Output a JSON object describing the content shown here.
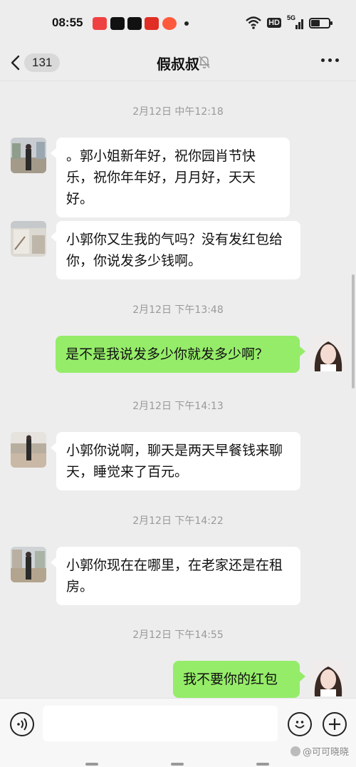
{
  "status_bar": {
    "time": "08:55",
    "app_icons": [
      {
        "name": "toutiao-app-icon",
        "color": "#f04142"
      },
      {
        "name": "douyin-app-icon",
        "color": "#111111"
      },
      {
        "name": "douyin-app-icon-2",
        "color": "#111111"
      },
      {
        "name": "pinduoduo-app-icon",
        "color": "#e02e24"
      },
      {
        "name": "kuaishou-app-icon",
        "color": "#ff5a3c"
      }
    ],
    "hd_label": "HD",
    "network": "5G"
  },
  "nav": {
    "unread_count": "131",
    "title": "假叔叔"
  },
  "messages": [
    {
      "type": "time",
      "text": "2月12日 中午12:18"
    },
    {
      "type": "in",
      "text": "。郭小姐新年好，祝你园肖节快乐，祝你年年好，月月好，天天好。"
    },
    {
      "type": "in",
      "text": "小郭你又生我的气吗？没有发红包给你，你说发多少钱啊。"
    },
    {
      "type": "time",
      "text": "2月12日 下午13:48"
    },
    {
      "type": "out",
      "text": "是不是我说发多少你就发多少啊？"
    },
    {
      "type": "time",
      "text": "2月12日 下午14:13"
    },
    {
      "type": "in",
      "text": "小郭你说啊，聊天是两天早餐钱来聊天，睡觉来了百元。"
    },
    {
      "type": "time",
      "text": "2月12日 下午14:22"
    },
    {
      "type": "in",
      "text": "小郭你现在在哪里，在老家还是在租房。"
    },
    {
      "type": "time",
      "text": "2月12日 下午14:55"
    },
    {
      "type": "out",
      "text": "我不要你的红包"
    }
  ],
  "input": {
    "value": ""
  },
  "watermark": "@可可晓晓",
  "colors": {
    "background": "#ededed",
    "bubble_in": "#ffffff",
    "bubble_out": "#95ec69",
    "timestamp": "#999999"
  }
}
